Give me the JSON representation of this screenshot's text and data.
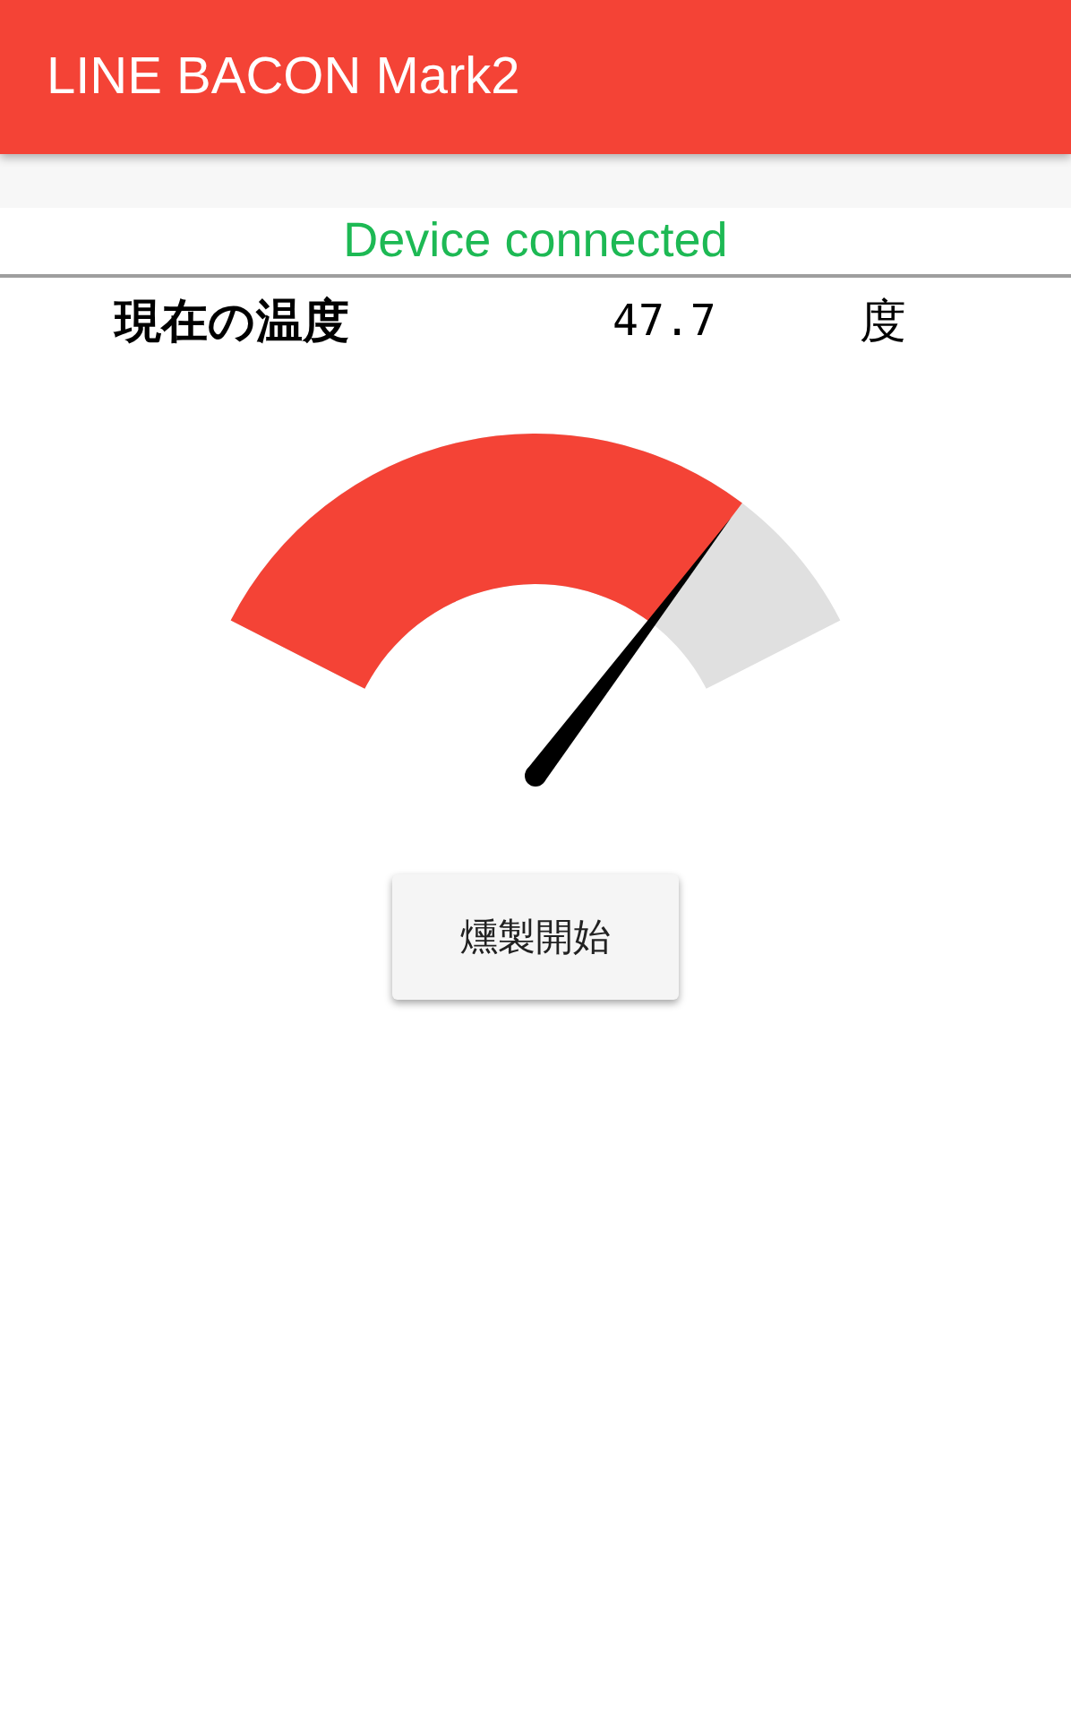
{
  "app_bar": {
    "title": "LINE BACON Mark2"
  },
  "status": {
    "text": "Device connected",
    "connected": true
  },
  "reading": {
    "label": "現在の温度",
    "value": "47.7",
    "unit": "度"
  },
  "gauge": {
    "level": 0.795
  },
  "buttons": [
    {
      "label": "燻製開始"
    }
  ]
}
